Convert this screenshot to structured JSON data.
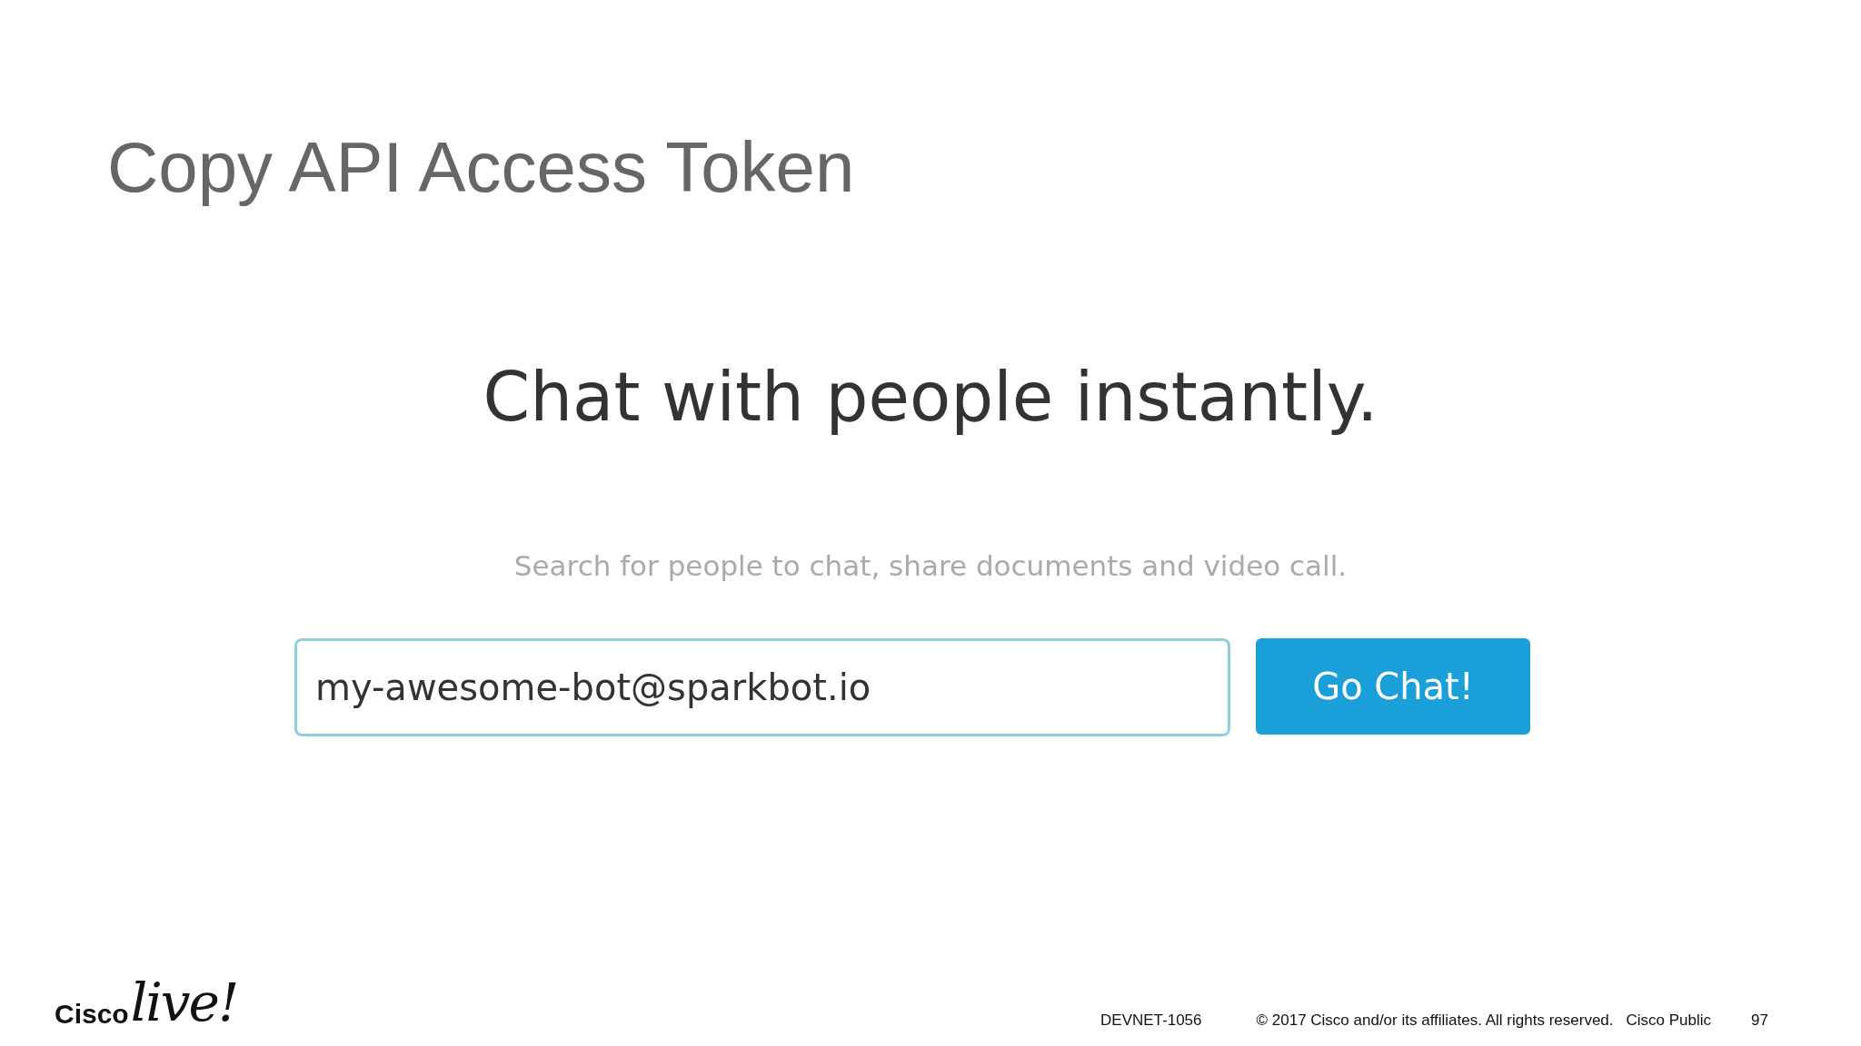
{
  "slide": {
    "title": "Copy API Access Token"
  },
  "screenshot": {
    "heading": "Chat with people instantly.",
    "subheading": "Search for people to chat, share documents and video call.",
    "search": {
      "value": "my-awesome-bot@sparkbot.io",
      "focused": true
    },
    "button": "Go Chat!"
  },
  "footer": {
    "logo_brand": "Cisco",
    "logo_event": "live!",
    "session": "DEVNET-1056",
    "copyright": "© 2017  Cisco and/or its affiliates. All rights reserved.",
    "classification": "Cisco Public",
    "page": "97"
  }
}
